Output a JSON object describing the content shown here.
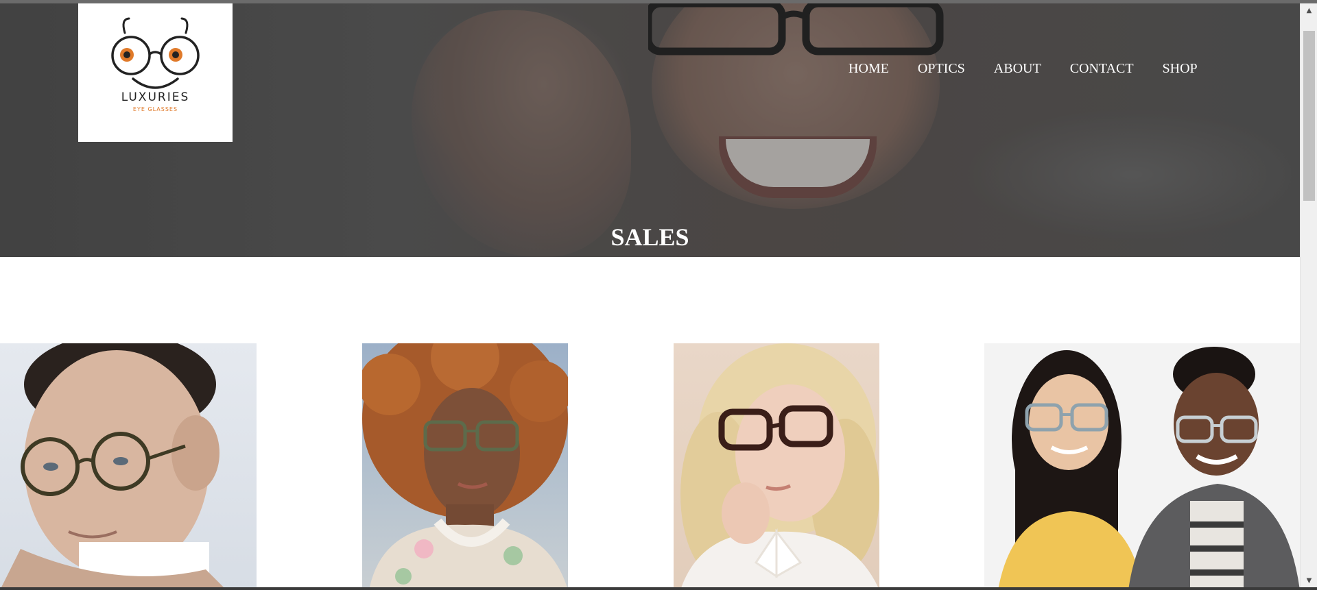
{
  "brand": {
    "name": "LUXURIES",
    "tagline": "EYE GLASSES",
    "accent_color": "#e07a2a"
  },
  "nav": {
    "items": [
      {
        "label": "HOME"
      },
      {
        "label": "OPTICS"
      },
      {
        "label": "ABOUT"
      },
      {
        "label": "CONTACT"
      },
      {
        "label": "SHOP"
      }
    ]
  },
  "hero": {
    "title": "SALES"
  },
  "gallery": {
    "photos": [
      {
        "subject": "man wearing round tortoiseshell glasses"
      },
      {
        "subject": "woman with curly hair wearing green frames"
      },
      {
        "subject": "blonde woman wearing dark tortoiseshell glasses"
      },
      {
        "subject": "two children wearing clear frames"
      }
    ]
  },
  "scrollbar": {
    "up_icon": "chevron-up-icon",
    "down_icon": "chevron-down-icon"
  }
}
